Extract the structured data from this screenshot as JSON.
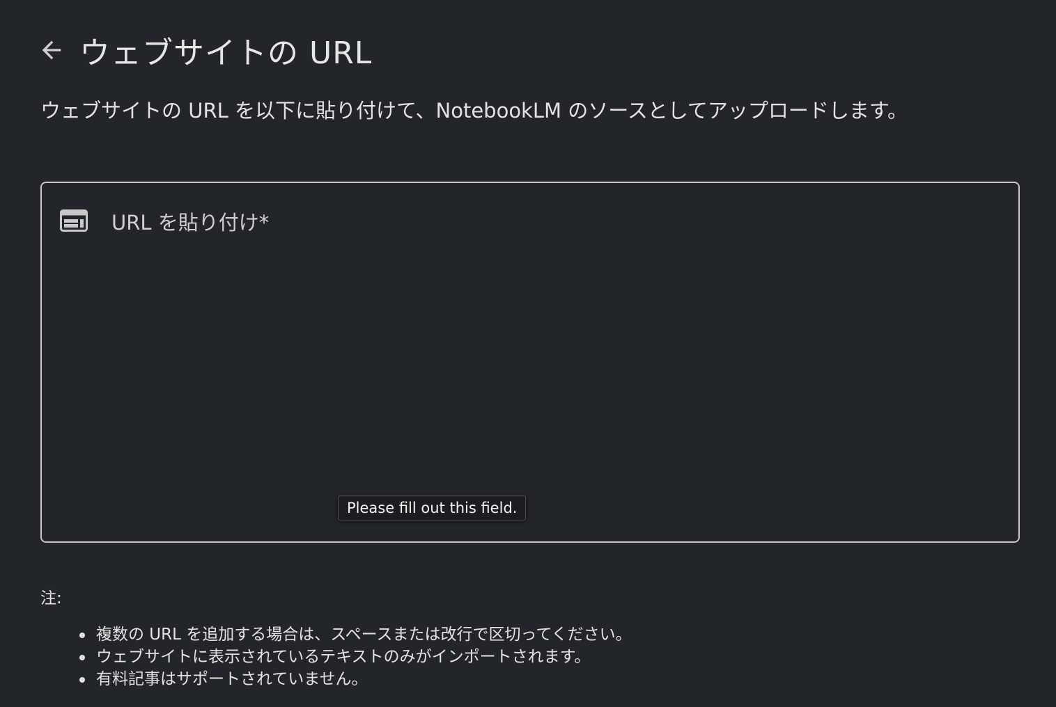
{
  "header": {
    "back_icon": "arrow-back-icon",
    "title": "ウェブサイトの URL"
  },
  "description": "ウェブサイトの URL を以下に貼り付けて、NotebookLM のソースとしてアップロードします。",
  "url_field": {
    "icon": "web-icon",
    "placeholder": "URL を貼り付け*",
    "value": ""
  },
  "tooltip": "Please fill out this field.",
  "notes": {
    "label": "注:",
    "items": [
      "複数の URL を追加する場合は、スペースまたは改行で区切ってください。",
      "ウェブサイトに表示されているテキストのみがインポートされます。",
      "有料記事はサポートされていません。"
    ]
  }
}
